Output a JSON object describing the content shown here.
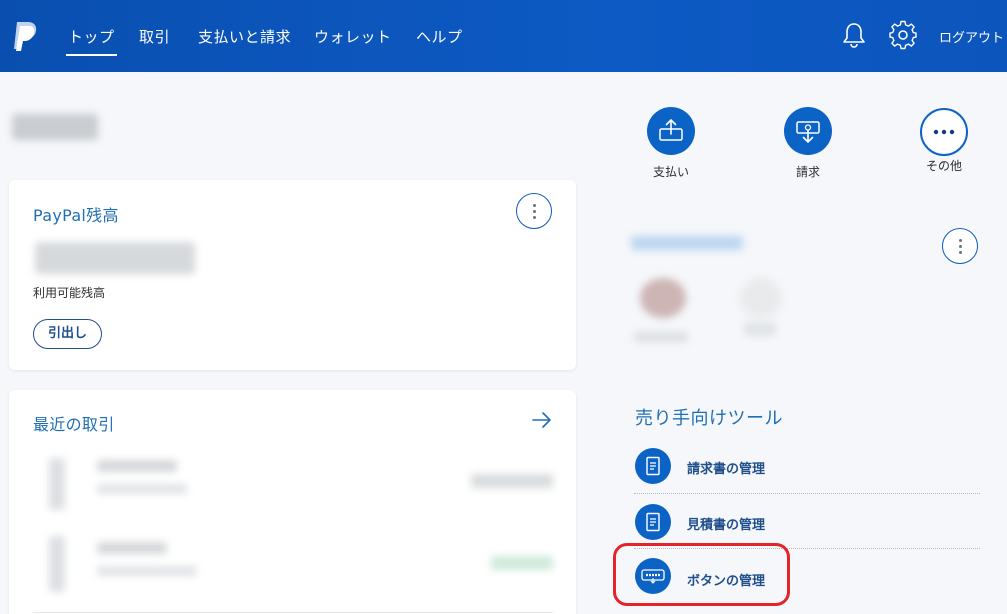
{
  "header": {
    "logo_icon": "paypal-logo-icon",
    "nav": [
      {
        "label": "トップ",
        "active": true
      },
      {
        "label": "取引"
      },
      {
        "label": "支払いと請求"
      },
      {
        "label": "ウォレット"
      },
      {
        "label": "ヘルプ"
      }
    ],
    "bell_icon": "bell-icon",
    "settings_icon": "gear-icon",
    "logout_label": "ログアウト"
  },
  "balance_card": {
    "title": "PayPal残高",
    "caption": "利用可能残高",
    "withdraw_label": "引出し"
  },
  "transactions_card": {
    "title": "最近の取引",
    "arrow_icon": "arrow-right-icon"
  },
  "quick_actions": [
    {
      "label": "支払い",
      "icon": "send-money-icon"
    },
    {
      "label": "請求",
      "icon": "request-money-icon"
    },
    {
      "label": "その他",
      "icon": "more-icon"
    }
  ],
  "seller_tools": {
    "title": "売り手向けツール",
    "items": [
      {
        "label": "請求書の管理",
        "icon": "invoice-icon"
      },
      {
        "label": "見積書の管理",
        "icon": "estimate-icon"
      },
      {
        "label": "ボタンの管理",
        "icon": "paypal-button-icon"
      }
    ]
  },
  "colors": {
    "brand_blue": "#0c63c6",
    "header_blue": "#0a4fb0",
    "title_blue": "#1f6fb5",
    "highlight_red": "#e3242b"
  }
}
